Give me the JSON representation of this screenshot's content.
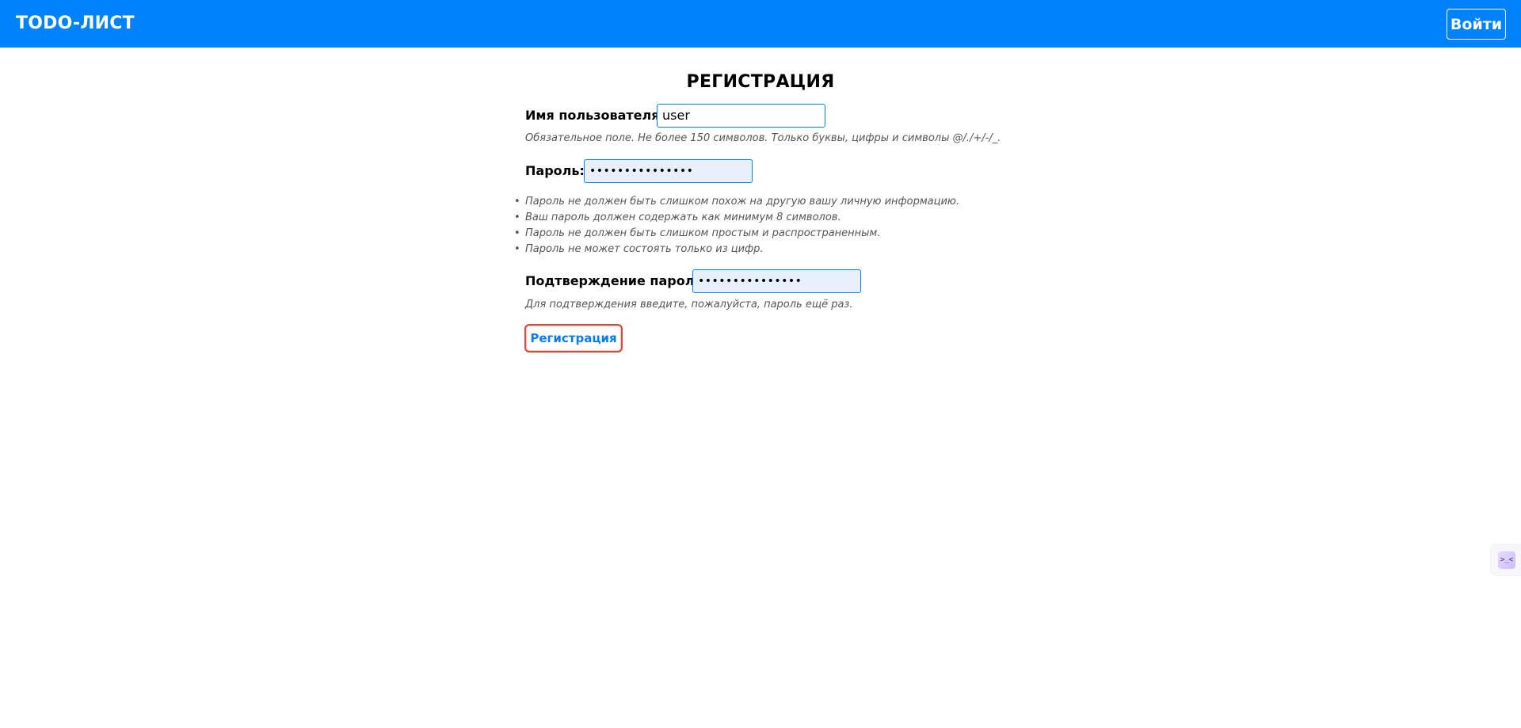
{
  "header": {
    "brand": "TODO-ЛИСТ",
    "login_label": "Войти"
  },
  "page": {
    "title": "РЕГИСТРАЦИЯ"
  },
  "form": {
    "username": {
      "label": "Имя пользователя:",
      "value": "user",
      "help": "Обязательное поле. Не более 150 символов. Только буквы, цифры и символы @/./+/-/_."
    },
    "password": {
      "label": "Пароль:",
      "value": "•••••••••••••••",
      "hints": [
        "Пароль не должен быть слишком похож на другую вашу личную информацию.",
        "Ваш пароль должен содержать как минимум 8 символов.",
        "Пароль не должен быть слишком простым и распространенным.",
        "Пароль не может состоять только из цифр."
      ]
    },
    "password_confirm": {
      "label": "Подтверждение пароля:",
      "value": "•••••••••••••••",
      "help": "Для подтверждения введите, пожалуйста, пароль ещё раз."
    },
    "submit_label": "Регистрация"
  },
  "widget": {
    "icon": "keyboard-shortcut-icon",
    "glyph": ">_<"
  },
  "colors": {
    "navbar": "#0082fb",
    "accent": "#0082fb",
    "autofill": "#e8f0fe",
    "focus_ring": "#d24c3b"
  }
}
